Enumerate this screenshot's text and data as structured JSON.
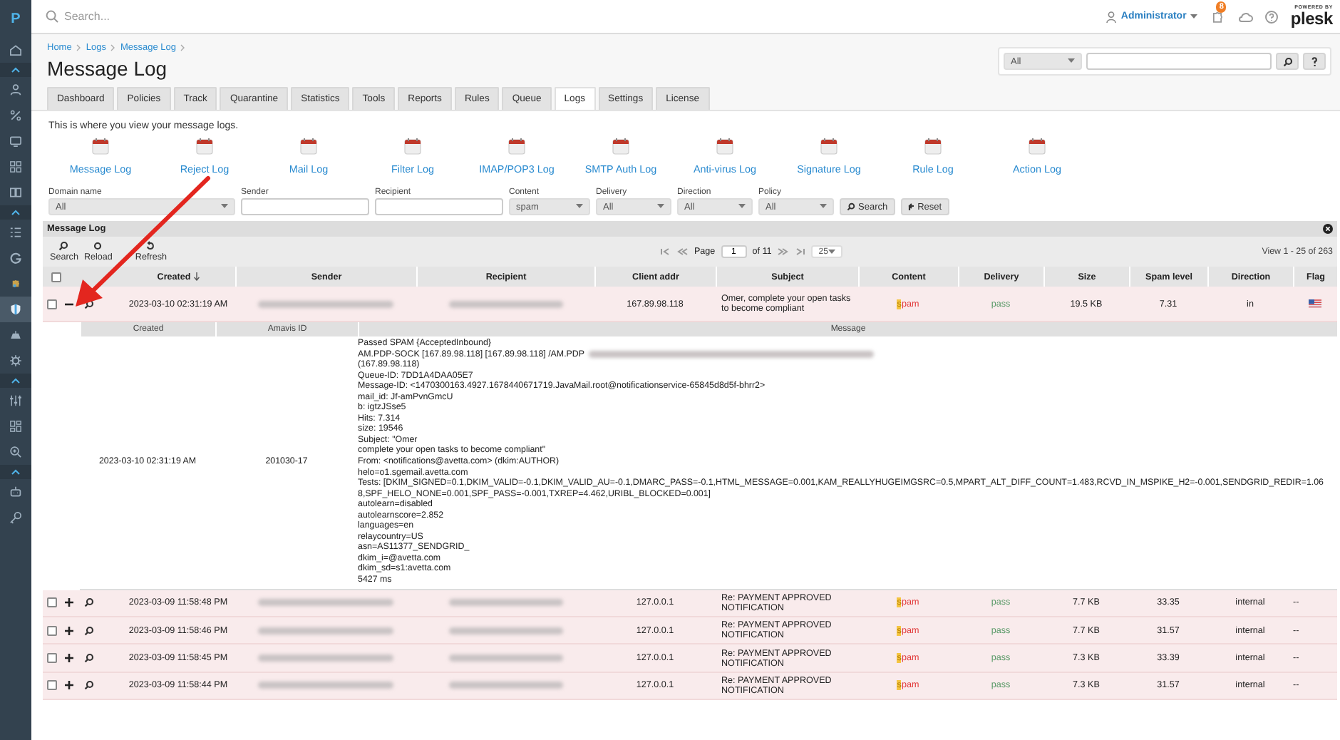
{
  "sidebar": {
    "logo": "P",
    "items": [
      {
        "kind": "link",
        "selected": false
      },
      {
        "kind": "toggle",
        "selected": false
      },
      {
        "kind": "link",
        "selected": false
      },
      {
        "kind": "link",
        "selected": false
      },
      {
        "kind": "link",
        "selected": false
      },
      {
        "kind": "link",
        "selected": false
      },
      {
        "kind": "link",
        "selected": false
      },
      {
        "kind": "toggle",
        "selected": false
      },
      {
        "kind": "link",
        "selected": false
      },
      {
        "kind": "link",
        "selected": false
      },
      {
        "kind": "link",
        "selected": false
      },
      {
        "kind": "link",
        "selected": true
      },
      {
        "kind": "link",
        "selected": false
      },
      {
        "kind": "link",
        "selected": false
      },
      {
        "kind": "toggle",
        "selected": false
      },
      {
        "kind": "link",
        "selected": false
      },
      {
        "kind": "link",
        "selected": false
      },
      {
        "kind": "link",
        "selected": false
      },
      {
        "kind": "toggle",
        "selected": false
      },
      {
        "kind": "link",
        "selected": false
      },
      {
        "kind": "link",
        "selected": false
      }
    ]
  },
  "top_bar": {
    "search_placeholder": "Search...",
    "user": "Administrator",
    "notification_count": "8",
    "brand_tagline": "POWERED BY",
    "brand": "plesk"
  },
  "breadcrumb": [
    "Home",
    "Logs",
    "Message Log"
  ],
  "page_title": "Message Log",
  "quick_search": {
    "scope": "All"
  },
  "tabs": [
    {
      "label": "Dashboard",
      "selected": false
    },
    {
      "label": "Policies",
      "selected": false
    },
    {
      "label": "Track",
      "selected": false
    },
    {
      "label": "Quarantine",
      "selected": false
    },
    {
      "label": "Statistics",
      "selected": false
    },
    {
      "label": "Tools",
      "selected": false
    },
    {
      "label": "Reports",
      "selected": false
    },
    {
      "label": "Rules",
      "selected": false
    },
    {
      "label": "Queue",
      "selected": false
    },
    {
      "label": "Logs",
      "selected": true
    },
    {
      "label": "Settings",
      "selected": false
    },
    {
      "label": "License",
      "selected": false
    }
  ],
  "intro": "This is where you view your message logs.",
  "log_links": [
    "Message Log",
    "Reject Log",
    "Mail Log",
    "Filter Log",
    "IMAP/POP3 Log",
    "SMTP Auth Log",
    "Anti-virus Log",
    "Signature Log",
    "Rule Log",
    "Action Log"
  ],
  "filters": [
    {
      "kind": "select",
      "label": "Domain name",
      "value": "All"
    },
    {
      "kind": "input",
      "label": "Sender"
    },
    {
      "kind": "input",
      "label": "Recipient"
    },
    {
      "kind": "select",
      "label": "Content",
      "value": "spam"
    },
    {
      "kind": "select",
      "label": "Delivery",
      "value": "All"
    },
    {
      "kind": "select",
      "label": "Direction",
      "value": "All"
    },
    {
      "kind": "select",
      "label": "Policy",
      "value": "All"
    }
  ],
  "filter_buttons": [
    {
      "kind": "search",
      "label": "Search"
    },
    {
      "kind": "reset",
      "label": "Reset"
    }
  ],
  "grid": {
    "title": "Message Log",
    "toolbar": [
      {
        "kind": "search",
        "label": "Search"
      },
      {
        "kind": "reload",
        "label": "Reload"
      },
      {
        "kind": "refresh",
        "label": "Refresh"
      }
    ],
    "pager": {
      "label": "Page",
      "page": "1",
      "of": "of 11",
      "page_size": "25"
    },
    "view_info": "View 1 - 25 of 263"
  },
  "table": {
    "select_all_checked": false,
    "columns": [
      {
        "label": "Created",
        "sorted": true
      },
      {
        "label": "Sender",
        "sorted": false
      },
      {
        "label": "Recipient",
        "sorted": false
      },
      {
        "label": "Client addr",
        "sorted": false
      },
      {
        "label": "Subject",
        "sorted": false
      },
      {
        "label": "Content",
        "sorted": false
      },
      {
        "label": "Delivery",
        "sorted": false
      },
      {
        "label": "Size",
        "sorted": false
      },
      {
        "label": "Spam level",
        "sorted": false
      },
      {
        "label": "Direction",
        "sorted": false
      },
      {
        "label": "Flag",
        "sorted": false
      }
    ],
    "rows": [
      {
        "checked": false,
        "expanded": true,
        "created": "2023-03-10 02:31:19 AM",
        "client_addr": "167.89.98.118",
        "subject": "Omer, complete your open tasks to become compliant",
        "content": "spam",
        "delivery": "pass",
        "size": "19.5 KB",
        "spam_level": "7.31",
        "direction": "in",
        "flag": {
          "kind": "icon"
        },
        "detail": {
          "columns": [
            "Created",
            "Amavis ID",
            "Message"
          ],
          "created": "2023-03-10 02:31:19 AM",
          "amavis_id": "201030-17",
          "message": [
            {
              "text": "Passed SPAM {AcceptedInbound}",
              "redacted": false
            },
            {
              "text": "AM.PDP-SOCK [167.89.98.118] [167.89.98.118] /AM.PDP",
              "redacted": true
            },
            {
              "text": "(167.89.98.118)",
              "redacted": false
            },
            {
              "text": "Queue-ID: 7DD1A4DAA05E7",
              "redacted": false
            },
            {
              "text": "Message-ID: <1470300163.4927.1678440671719.JavaMail.root@notificationservice-65845d8d5f-bhrr2>",
              "redacted": false
            },
            {
              "text": "mail_id: Jf-amPvnGmcU",
              "redacted": false
            },
            {
              "text": "b: igtzJSse5",
              "redacted": false
            },
            {
              "text": "Hits: 7.314",
              "redacted": false
            },
            {
              "text": "size: 19546",
              "redacted": false
            },
            {
              "text": "Subject: \"Omer",
              "redacted": false
            },
            {
              "text": "complete your open tasks to become compliant\"",
              "redacted": false
            },
            {
              "text": "From: <notifications@avetta.com> (dkim:AUTHOR)",
              "redacted": false
            },
            {
              "text": "helo=o1.sgemail.avetta.com",
              "redacted": false
            },
            {
              "text": "Tests: [DKIM_SIGNED=0.1,DKIM_VALID=-0.1,DKIM_VALID_AU=-0.1,DMARC_PASS=-0.1,HTML_MESSAGE=0.001,KAM_REALLYHUGEIMGSRC=0.5,MPART_ALT_DIFF_COUNT=1.483,RCVD_IN_MSPIKE_H2=-0.001,SENDGRID_REDIR=1.068,SPF_HELO_NONE=0.001,SPF_PASS=-0.001,TXREP=4.462,URIBL_BLOCKED=0.001]",
              "redacted": false
            },
            {
              "text": "autolearn=disabled",
              "redacted": false
            },
            {
              "text": "autolearnscore=2.852",
              "redacted": false
            },
            {
              "text": "languages=en",
              "redacted": false
            },
            {
              "text": "relaycountry=US",
              "redacted": false
            },
            {
              "text": "asn=AS11377_SENDGRID_",
              "redacted": false
            },
            {
              "text": "dkim_i=@avetta.com",
              "redacted": false
            },
            {
              "text": "dkim_sd=s1:avetta.com",
              "redacted": false
            },
            {
              "text": "5427 ms",
              "redacted": false
            }
          ]
        }
      },
      {
        "checked": false,
        "expanded": false,
        "created": "2023-03-09 11:58:48 PM",
        "client_addr": "127.0.0.1",
        "subject": "Re: PAYMENT APPROVED NOTIFICATION",
        "content": "spam",
        "delivery": "pass",
        "size": "7.7 KB",
        "spam_level": "33.35",
        "direction": "internal",
        "flag": {
          "kind": "text",
          "text": "--"
        }
      },
      {
        "checked": false,
        "expanded": false,
        "created": "2023-03-09 11:58:46 PM",
        "client_addr": "127.0.0.1",
        "subject": "Re: PAYMENT APPROVED NOTIFICATION",
        "content": "spam",
        "delivery": "pass",
        "size": "7.7 KB",
        "spam_level": "31.57",
        "direction": "internal",
        "flag": {
          "kind": "text",
          "text": "--"
        }
      },
      {
        "checked": false,
        "expanded": false,
        "created": "2023-03-09 11:58:45 PM",
        "client_addr": "127.0.0.1",
        "subject": "Re: PAYMENT APPROVED NOTIFICATION",
        "content": "spam",
        "delivery": "pass",
        "size": "7.3 KB",
        "spam_level": "33.39",
        "direction": "internal",
        "flag": {
          "kind": "text",
          "text": "--"
        }
      },
      {
        "checked": false,
        "expanded": false,
        "created": "2023-03-09 11:58:44 PM",
        "client_addr": "127.0.0.1",
        "subject": "Re: PAYMENT APPROVED NOTIFICATION",
        "content": "spam",
        "delivery": "pass",
        "size": "7.3 KB",
        "spam_level": "31.57",
        "direction": "internal",
        "flag": {
          "kind": "text",
          "text": "--"
        }
      }
    ]
  }
}
